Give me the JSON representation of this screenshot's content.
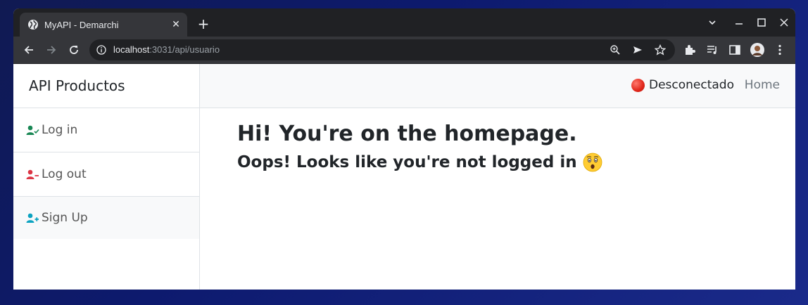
{
  "browser": {
    "tab_title": "MyAPI - Demarchi",
    "url_host": "localhost",
    "url_rest": ":3031/api/usuario"
  },
  "sidebar": {
    "brand": "API Productos",
    "items": [
      {
        "label": "Log in",
        "icon": "user-check-icon",
        "color": "#198754"
      },
      {
        "label": "Log out",
        "icon": "user-minus-icon",
        "color": "#dc3545"
      },
      {
        "label": "Sign Up",
        "icon": "user-plus-icon",
        "color": "#0dcaf0"
      }
    ]
  },
  "topnav": {
    "status_label": "Desconectado",
    "status_color": "#dc3545",
    "home_label": "Home"
  },
  "main": {
    "heading": "Hi! You're on the homepage.",
    "subheading": "Oops! Looks like you're not logged in"
  }
}
